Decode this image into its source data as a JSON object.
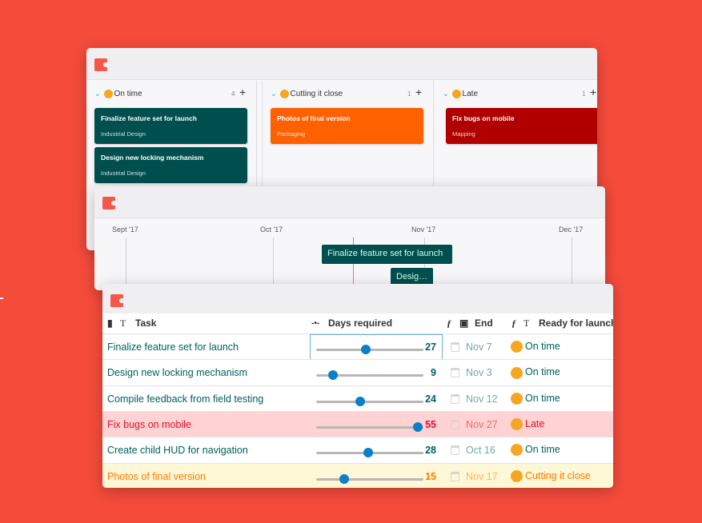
{
  "colors": {
    "background": "#f54b3b",
    "on_time": "#004f4f",
    "cutting": "#ff6000",
    "late": "#b00000",
    "accent": "#0a80c8"
  },
  "kanban": {
    "columns": [
      {
        "title": "On time",
        "count": "4",
        "emoji": "grinning-face",
        "cards": [
          {
            "title": "Finalize feature set for launch",
            "subtitle": "Industrial Design"
          },
          {
            "title": "Design new locking mechanism",
            "subtitle": "Industrial Design"
          }
        ]
      },
      {
        "title": "Cutting it close",
        "count": "1",
        "emoji": "grimacing-face",
        "cards": [
          {
            "title": "Photos of final version",
            "subtitle": "Packaging"
          }
        ]
      },
      {
        "title": "Late",
        "count": "1",
        "emoji": "astonished-face",
        "cards": [
          {
            "title": "Fix bugs on mobile",
            "subtitle": "Mapping"
          }
        ]
      }
    ]
  },
  "timeline": {
    "months": [
      "Sept '17",
      "Oct '17",
      "Nov '17",
      "Dec '17"
    ],
    "bars": [
      "Finalize feature set for launch",
      "Desig…"
    ]
  },
  "table": {
    "headers": {
      "task": "Task",
      "days": "Days required",
      "end": "End",
      "ready": "Ready for launch"
    },
    "slider_max": 58,
    "rows": [
      {
        "task": "Finalize feature set for launch",
        "days": 27,
        "days_label": "27",
        "end": "Nov 7",
        "ready": "On time",
        "status": "ontime",
        "selected": true
      },
      {
        "task": "Design new locking mechanism",
        "days": 9,
        "days_label": "9",
        "end": "Nov 3",
        "ready": "On time",
        "status": "ontime"
      },
      {
        "task": "Compile feedback from field testing",
        "days": 24,
        "days_label": "24",
        "end": "Nov 12",
        "ready": "On time",
        "status": "ontime"
      },
      {
        "task": "Fix bugs on mobile",
        "days": 55,
        "days_label": "55",
        "end": "Nov 27",
        "ready": "Late",
        "status": "late"
      },
      {
        "task": "Create child HUD for navigation",
        "days": 28,
        "days_label": "28",
        "end": "Oct 16",
        "ready": "On time",
        "status": "ontime"
      },
      {
        "task": "Photos of final version",
        "days": 15,
        "days_label": "15",
        "end": "Nov 17",
        "ready": "Cutting it close",
        "status": "cutting"
      }
    ]
  }
}
